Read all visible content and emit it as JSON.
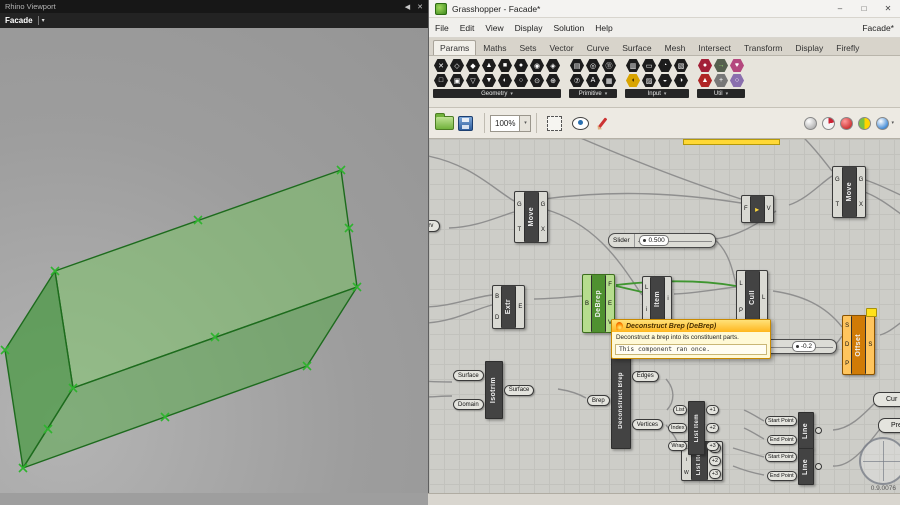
{
  "icons": {
    "caret_down": "▾",
    "minimize": "–",
    "maximize": "□",
    "close": "✕",
    "collapse": "◀"
  },
  "theme": {
    "selected_green": "#4f9130",
    "warning_orange": "#d07b06",
    "wire_gray": "#8f8f8f",
    "selected_wire": "#3f9630",
    "canvas_bg": "#cdcdc8",
    "box_green": "#4caf50"
  },
  "rhino": {
    "title": "Rhino Viewport",
    "tab_label": "Facade"
  },
  "gh": {
    "title": "Grasshopper - Facade*",
    "menus": [
      "File",
      "Edit",
      "View",
      "Display",
      "Solution",
      "Help"
    ],
    "menu_right": "Facade*",
    "tabs": [
      "Params",
      "Maths",
      "Sets",
      "Vector",
      "Curve",
      "Surface",
      "Mesh",
      "Intersect",
      "Transform",
      "Display",
      "Firefly"
    ],
    "active_tab": "Params",
    "groups": [
      {
        "label": "Geometry",
        "row1": [
          "✕",
          "◇",
          "◆",
          "▲",
          "■",
          "●",
          "◉",
          "◈"
        ],
        "row2": [
          "□",
          "▣",
          "▽",
          "▼",
          "◐",
          "○",
          "⊙",
          "⊕"
        ]
      },
      {
        "label": "Primitive",
        "row1": [
          "▤",
          "◎",
          "⑪"
        ],
        "row2": [
          "⑦",
          "A",
          "▦"
        ]
      },
      {
        "label": "Input",
        "row1": [
          "▥",
          "▭",
          "◔",
          "▧"
        ],
        "row2": [
          "◖",
          "▨",
          "◒",
          "◑"
        ]
      },
      {
        "label": "Util",
        "row1": [
          "●",
          "→",
          "♥"
        ],
        "row2": [
          "▲",
          "+",
          "○"
        ]
      }
    ],
    "toolbar2": {
      "zoom": "100%"
    },
    "canvas": {
      "version": "0.9.0076",
      "crv": {
        "label": "Crv"
      },
      "move1": {
        "label": "Move",
        "inputs": [
          "G",
          "T"
        ],
        "outputs": [
          "G",
          "X"
        ]
      },
      "move2": {
        "label": "Move",
        "inputs": [
          "G",
          "T"
        ],
        "outputs": [
          "G",
          "X"
        ]
      },
      "slider1": {
        "name": "Slider",
        "value": "0.500"
      },
      "slider2": {
        "value": "-0.2"
      },
      "gate": {
        "glyph": "▸",
        "inputs": [
          "F"
        ],
        "outputs": [
          "V"
        ]
      },
      "extr": {
        "label": "Extr",
        "inputs": [
          "B",
          "D"
        ],
        "outputs": [
          "E"
        ]
      },
      "debrep": {
        "label": "DeBrep",
        "inputs": [
          "B"
        ],
        "outputs": [
          "F",
          "E",
          "V"
        ]
      },
      "item": {
        "label": "Item",
        "inputs": [
          "L",
          "i"
        ],
        "outputs": [
          "i"
        ]
      },
      "cull": {
        "label": "Cull",
        "inputs": [
          "L",
          "P"
        ],
        "outputs": [
          "L"
        ]
      },
      "isotrim": {
        "label": "Isotrim",
        "inputs": [
          "Surface",
          "Domain"
        ],
        "outputs": [
          "Surface"
        ]
      },
      "deconbrep": {
        "label": "Deconstruct Brep",
        "inputs": [
          "Brep"
        ],
        "outputs": [
          "Edges",
          "Vertices"
        ]
      },
      "listitem1": {
        "label": "List Item",
        "inputs": [
          "List",
          "Index",
          "Wrap"
        ],
        "outputs": [
          "+1",
          "+2",
          "+3"
        ]
      },
      "listitem2": {
        "label": "List Item",
        "inputs": [
          "L",
          "i",
          "W"
        ],
        "outputs": [
          "+1",
          "+2",
          "+3"
        ]
      },
      "line1": {
        "label": "Line",
        "inputs": [
          "Start Point",
          "End Point"
        ]
      },
      "line2": {
        "label": "Line",
        "inputs": [
          "Start Point",
          "End Point"
        ]
      },
      "offset": {
        "label": "Offset",
        "inputs": [
          "S",
          "D",
          "P"
        ],
        "outputs": [
          "S"
        ]
      },
      "cur": {
        "label": "Cur"
      },
      "pres": {
        "label": "Pres"
      },
      "tooltip": {
        "title": "Deconstruct Brep (DeBrep)",
        "body": "Deconstruct a brep into its constituent parts.",
        "status": "This component ran once."
      }
    }
  }
}
